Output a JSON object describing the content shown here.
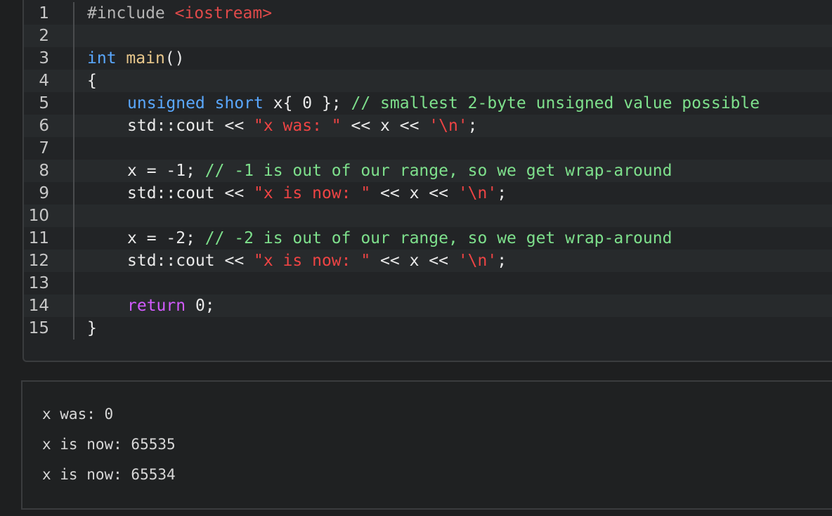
{
  "editor": {
    "lines": [
      {
        "number": "1",
        "tokens": [
          {
            "cls": "tok-preproc",
            "text": "#include "
          },
          {
            "cls": "tok-header",
            "text": "<iostream>"
          }
        ]
      },
      {
        "number": "2",
        "tokens": []
      },
      {
        "number": "3",
        "tokens": [
          {
            "cls": "tok-type",
            "text": "int"
          },
          {
            "cls": "tok-plain",
            "text": " "
          },
          {
            "cls": "tok-func",
            "text": "main"
          },
          {
            "cls": "tok-plain",
            "text": "()"
          }
        ]
      },
      {
        "number": "4",
        "tokens": [
          {
            "cls": "tok-plain",
            "text": "{"
          }
        ]
      },
      {
        "number": "5",
        "indent": true,
        "tokens": [
          {
            "cls": "tok-type",
            "text": "unsigned short"
          },
          {
            "cls": "tok-plain",
            "text": " x{ 0 }; "
          },
          {
            "cls": "tok-comment",
            "text": "// smallest 2-byte unsigned value possible"
          }
        ]
      },
      {
        "number": "6",
        "indent": true,
        "tokens": [
          {
            "cls": "tok-plain",
            "text": "std::cout << "
          },
          {
            "cls": "tok-string",
            "text": "\"x was: \""
          },
          {
            "cls": "tok-plain",
            "text": " << x << "
          },
          {
            "cls": "tok-string",
            "text": "'\\n'"
          },
          {
            "cls": "tok-plain",
            "text": ";"
          }
        ]
      },
      {
        "number": "7",
        "tokens": []
      },
      {
        "number": "8",
        "indent": true,
        "tokens": [
          {
            "cls": "tok-plain",
            "text": "x = -1; "
          },
          {
            "cls": "tok-comment",
            "text": "// -1 is out of our range, so we get wrap-around"
          }
        ]
      },
      {
        "number": "9",
        "indent": true,
        "tokens": [
          {
            "cls": "tok-plain",
            "text": "std::cout << "
          },
          {
            "cls": "tok-string",
            "text": "\"x is now: \""
          },
          {
            "cls": "tok-plain",
            "text": " << x << "
          },
          {
            "cls": "tok-string",
            "text": "'\\n'"
          },
          {
            "cls": "tok-plain",
            "text": ";"
          }
        ]
      },
      {
        "number": "10",
        "tokens": []
      },
      {
        "number": "11",
        "indent": true,
        "tokens": [
          {
            "cls": "tok-plain",
            "text": "x = -2; "
          },
          {
            "cls": "tok-comment",
            "text": "// -2 is out of our range, so we get wrap-around"
          }
        ]
      },
      {
        "number": "12",
        "indent": true,
        "tokens": [
          {
            "cls": "tok-plain",
            "text": "std::cout << "
          },
          {
            "cls": "tok-string",
            "text": "\"x is now: \""
          },
          {
            "cls": "tok-plain",
            "text": " << x << "
          },
          {
            "cls": "tok-string",
            "text": "'\\n'"
          },
          {
            "cls": "tok-plain",
            "text": ";"
          }
        ]
      },
      {
        "number": "13",
        "tokens": []
      },
      {
        "number": "14",
        "indent": true,
        "tokens": [
          {
            "cls": "tok-keyword",
            "text": "return"
          },
          {
            "cls": "tok-plain",
            "text": " 0;"
          }
        ]
      },
      {
        "number": "15",
        "tokens": [
          {
            "cls": "tok-plain",
            "text": "}"
          }
        ]
      }
    ]
  },
  "output": {
    "lines": [
      "x was: 0",
      "x is now: 65535",
      "x is now: 65534"
    ]
  },
  "colors": {
    "type": "#5aa8ff",
    "function": "#e9c88c",
    "string": "#ee4444",
    "comment": "#7ee08c",
    "keyword": "#d25bff",
    "background": "#222426"
  }
}
